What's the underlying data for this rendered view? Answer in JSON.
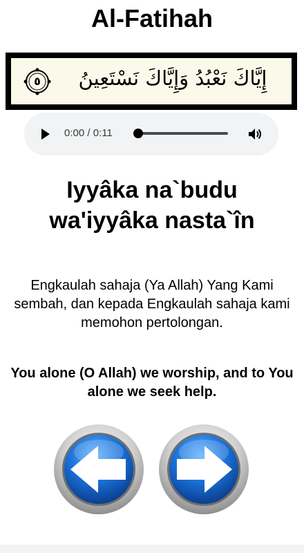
{
  "page": {
    "title": "Al-Fatihah"
  },
  "verse": {
    "arabic": "إِيَّاكَ نَعْبُدُ وَإِيَّاكَ نَسْتَعِينُ",
    "ayah_number": "٥"
  },
  "audio": {
    "time_display": "0:00 / 0:11",
    "progress": 0,
    "icons": {
      "play": "play-icon",
      "volume": "volume-icon"
    }
  },
  "transliteration": {
    "line1": "Iyyâka na`budu",
    "line2": "wa'iyyâka nasta`în"
  },
  "translation": {
    "malay": "Engkaulah sahaja (Ya Allah) Yang Kami sembah, dan kepada Engkaulah sahaja kami memohon pertolongan.",
    "english": "You alone (O Allah) we worship, and to You alone we seek help."
  },
  "navigation": {
    "prev_icon": "arrow-left-icon",
    "next_icon": "arrow-right-icon",
    "colors": {
      "button_blue": "#1a6fd6",
      "ring": "#c9c9c9",
      "arrow": "#ffffff"
    }
  }
}
